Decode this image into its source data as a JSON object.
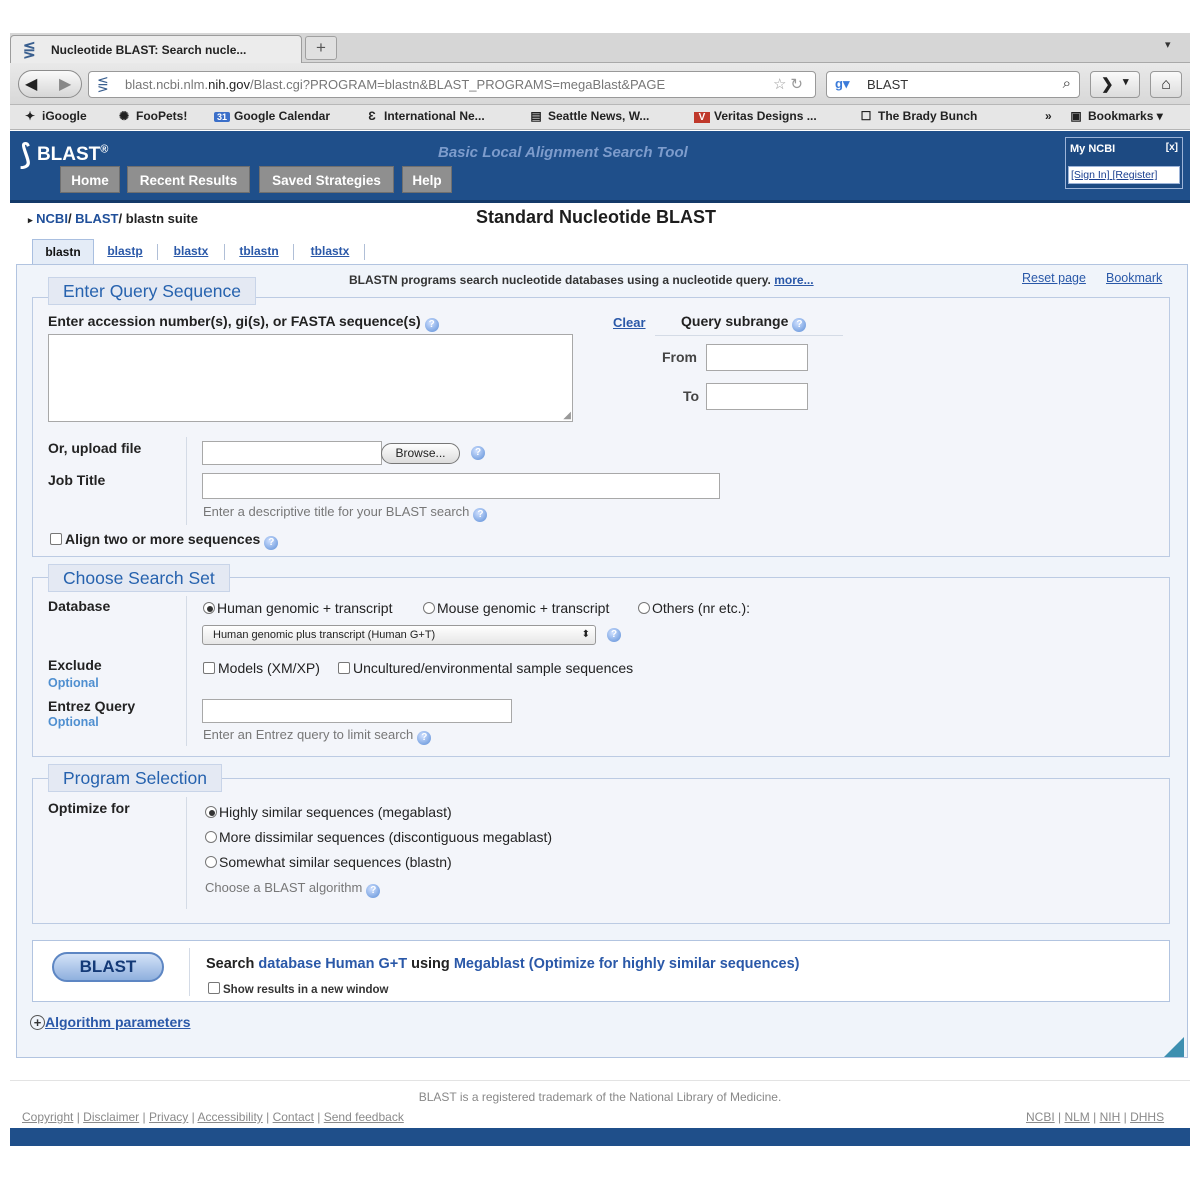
{
  "browser": {
    "tab_title": "Nucleotide BLAST: Search nucle...",
    "new_tab": "+",
    "url_prefix": "blast.ncbi.nlm.",
    "url_domain": "nih.gov",
    "url_path": "/Blast.cgi?PROGRAM=blastn&BLAST_PROGRAMS=megaBlast&PAGE",
    "search_engine_value": "BLAST",
    "bookmarks": [
      "iGoogle",
      "FooPets!",
      "Google Calendar",
      "International Ne...",
      "Seattle News, W...",
      "Veritas Designs ...",
      "The Brady Bunch"
    ],
    "overflow": "»",
    "bookmarks_menu": "Bookmarks"
  },
  "header": {
    "logo_text": "BLAST",
    "logo_reg": "®",
    "tagline": "Basic Local Alignment Search Tool",
    "nav": [
      "Home",
      "Recent Results",
      "Saved Strategies",
      "Help"
    ],
    "myncbi_title": "My NCBI",
    "myncbi_close": "[x]",
    "signin": "[Sign In]",
    "register": "[Register]"
  },
  "breadcrumb": {
    "ncbi": "NCBI",
    "blast": "BLAST",
    "suite": "blastn suite"
  },
  "page_title": "Standard Nucleotide BLAST",
  "program_tabs": [
    "blastn",
    "blastp",
    "blastx",
    "tblastn",
    "tblastx"
  ],
  "info": {
    "description": "BLASTN programs search nucleotide databases using a nucleotide query.",
    "more": "more...",
    "reset": "Reset page",
    "bookmark": "Bookmark"
  },
  "query": {
    "section_title": "Enter Query Sequence",
    "label": "Enter accession number(s), gi(s), or FASTA sequence(s)",
    "clear": "Clear",
    "subrange_label": "Query subrange",
    "from_label": "From",
    "to_label": "To",
    "upload_label": "Or, upload file",
    "browse": "Browse...",
    "job_title_label": "Job Title",
    "job_title_hint": "Enter a descriptive title for your BLAST search",
    "align_two": "Align two or more sequences"
  },
  "search_set": {
    "section_title": "Choose Search Set",
    "database_label": "Database",
    "db_options": [
      "Human genomic + transcript",
      "Mouse genomic + transcript",
      "Others (nr etc.):"
    ],
    "db_select_value": "Human genomic plus transcript (Human G+T)",
    "exclude_label": "Exclude",
    "optional": "Optional",
    "exclude_models": "Models (XM/XP)",
    "exclude_uncultured": "Uncultured/environmental sample sequences",
    "entrez_label": "Entrez Query",
    "entrez_hint": "Enter an Entrez query to limit search"
  },
  "program": {
    "section_title": "Program Selection",
    "optimize_label": "Optimize for",
    "options": [
      "Highly similar sequences (megablast)",
      "More dissimilar sequences (discontiguous megablast)",
      "Somewhat similar sequences (blastn)"
    ],
    "hint": "Choose a BLAST algorithm"
  },
  "submit": {
    "button": "BLAST",
    "summary_prefix": "Search",
    "summary_db": "database Human G+T",
    "summary_using": "using",
    "summary_algo": "Megablast (Optimize for highly similar sequences)",
    "new_window": "Show results in a new window",
    "algorithm_parameters": "Algorithm parameters"
  },
  "footer": {
    "trademark": "BLAST is a registered trademark of the National Library of Medicine.",
    "links": [
      "Copyright",
      "Disclaimer",
      "Privacy",
      "Accessibility",
      "Contact",
      "Send feedback"
    ],
    "right_links": [
      "NCBI",
      "NLM",
      "NIH",
      "DHHS"
    ]
  },
  "colors": {
    "header_blue": "#1f4f8a",
    "section_title_blue": "#2662ae",
    "link_blue": "#2a58a8"
  }
}
